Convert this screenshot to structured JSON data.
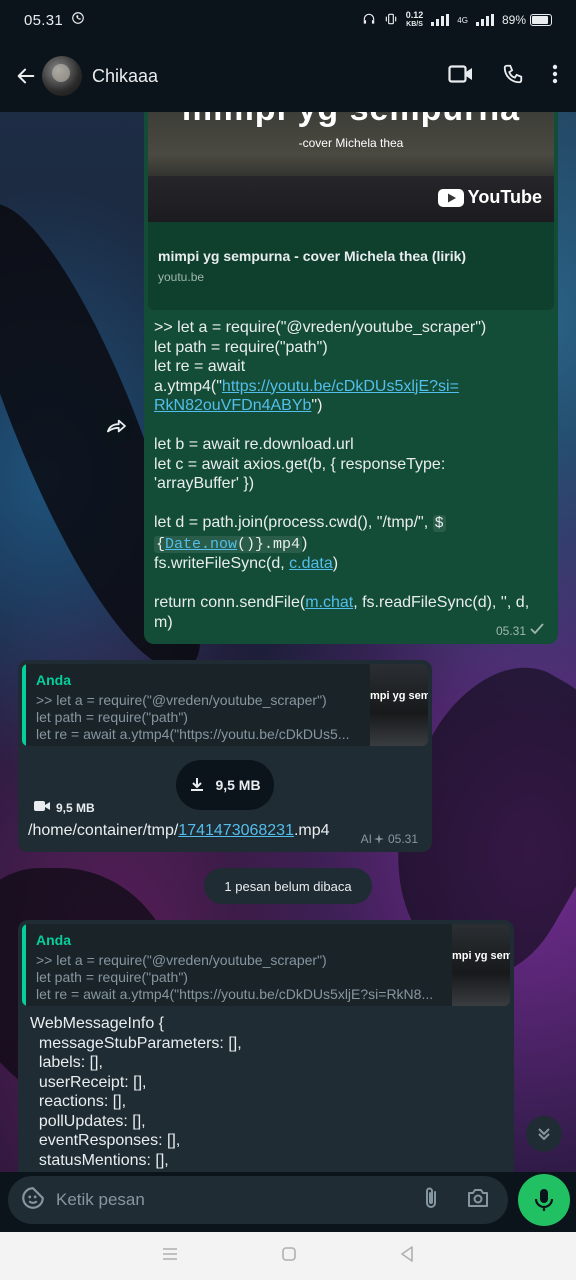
{
  "status_bar": {
    "time": "05.31",
    "net_speed_value": "0.12",
    "net_speed_unit": "KB/S",
    "battery": "89%",
    "network_label": "4G"
  },
  "header": {
    "contact_name": "Chikaaa"
  },
  "messages": [
    {
      "link_preview": {
        "thumb_title": "mimpi yg sempurna",
        "thumb_subtitle": "-cover Michela thea",
        "thumb_brand": "YouTube",
        "title": "mimpi yg sempurna - cover Michela thea (lirik)",
        "domain": "youtu.be"
      },
      "text_lines": {
        "l1": ">> let a = require(\"@vreden/youtube_scraper\")",
        "l2": "let path = require(\"path\")",
        "l3": "let re = await",
        "l4_pre": "a.ytmp4(\"",
        "l4_link": "https://youtu.be/cDkDUs5xljE?si=",
        "l5_link": "RkN82ouVFDn4ABYb",
        "l5_post": "\")",
        "l6": "let b = await re.download.url",
        "l7": "let c = await axios.get(b, { responseType:",
        "l8": "'arrayBuffer' })",
        "l9": "let d = path.join(process.cwd(), \"/tmp/\", ",
        "l9_code": "$",
        "l10_code_open": "{",
        "l10_link": "Date.now",
        "l10_code_close": "()}.mp4",
        "l10_post": ")",
        "l11_pre": "fs.writeFileSync(d, ",
        "l11_link": "c.data",
        "l11_post": ")",
        "l12_pre": "return conn.sendFile(",
        "l12_link": "m.chat",
        "l12_post": ", fs.readFileSync(d), '', d,",
        "l13": "m)"
      },
      "time": "05.31"
    },
    {
      "quote": {
        "sender": "Anda",
        "lines": [
          ">> let a = require(\"@vreden/youtube_scraper\")",
          "let path = require(\"path\")",
          "let re = await a.ytmp4(\"https://youtu.be/cDkDUs5..."
        ],
        "thumb_text": "mpi yg sempu"
      },
      "download_size": "9,5 MB",
      "video_size": "9,5 MB",
      "caption_pre": "/home/container/tmp/",
      "caption_link": "1741473068231",
      "caption_post": ".mp4",
      "ai_label": "AI",
      "time": "05.31"
    },
    {
      "quote": {
        "sender": "Anda",
        "lines": [
          ">> let a = require(\"@vreden/youtube_scraper\")",
          "let path = require(\"path\")",
          "let re = await a.ytmp4(\"https://youtu.be/cDkDUs5xljE?si=RkN8..."
        ],
        "thumb_text": "mpi yg sempu"
      },
      "code_lines": [
        "WebMessageInfo {",
        "  messageStubParameters: [],",
        "  labels: [],",
        "  userReceipt: [],",
        "  reactions: [],",
        "  pollUpdates: [],",
        "  eventResponses: [],",
        "  statusMentions: [],"
      ]
    }
  ],
  "unread_banner": "1 pesan belum dibaca",
  "composer": {
    "placeholder": "Ketik pesan"
  },
  "colors": {
    "outgoing_bubble": "#144d37",
    "incoming_bubble": "#1f2c34",
    "accent": "#06cf9c",
    "link": "#53bdeb",
    "mic_button": "#21c063"
  }
}
